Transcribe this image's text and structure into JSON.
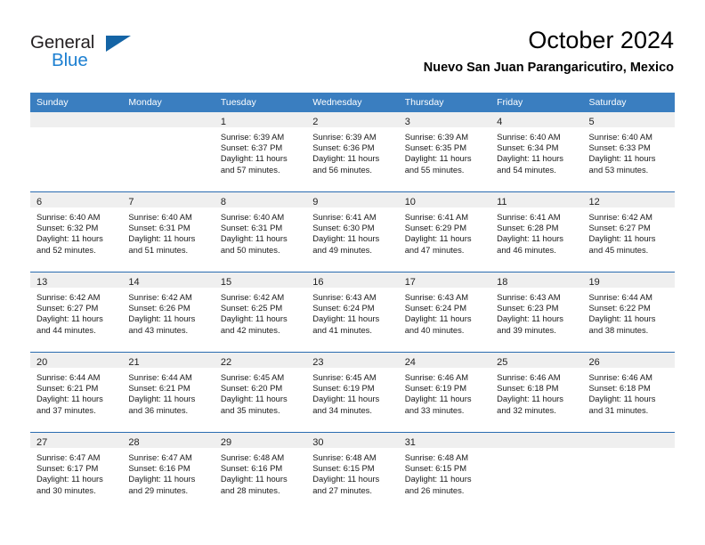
{
  "brand": {
    "name_part1": "General",
    "name_part2": "Blue",
    "logo_icon": "triangle-icon"
  },
  "header": {
    "title": "October 2024",
    "subtitle": "Nuevo San Juan Parangaricutiro, Mexico"
  },
  "calendar": {
    "weekday_headers": [
      "Sunday",
      "Monday",
      "Tuesday",
      "Wednesday",
      "Thursday",
      "Friday",
      "Saturday"
    ],
    "accent_color": "#3a7ec0",
    "separator_color": "#2a6cb0",
    "daynum_band_color": "#efefef",
    "weeks": [
      [
        {
          "day": "",
          "sunrise": "",
          "sunset": "",
          "daylight_line1": "",
          "daylight_line2": ""
        },
        {
          "day": "",
          "sunrise": "",
          "sunset": "",
          "daylight_line1": "",
          "daylight_line2": ""
        },
        {
          "day": "1",
          "sunrise": "Sunrise: 6:39 AM",
          "sunset": "Sunset: 6:37 PM",
          "daylight_line1": "Daylight: 11 hours",
          "daylight_line2": "and 57 minutes."
        },
        {
          "day": "2",
          "sunrise": "Sunrise: 6:39 AM",
          "sunset": "Sunset: 6:36 PM",
          "daylight_line1": "Daylight: 11 hours",
          "daylight_line2": "and 56 minutes."
        },
        {
          "day": "3",
          "sunrise": "Sunrise: 6:39 AM",
          "sunset": "Sunset: 6:35 PM",
          "daylight_line1": "Daylight: 11 hours",
          "daylight_line2": "and 55 minutes."
        },
        {
          "day": "4",
          "sunrise": "Sunrise: 6:40 AM",
          "sunset": "Sunset: 6:34 PM",
          "daylight_line1": "Daylight: 11 hours",
          "daylight_line2": "and 54 minutes."
        },
        {
          "day": "5",
          "sunrise": "Sunrise: 6:40 AM",
          "sunset": "Sunset: 6:33 PM",
          "daylight_line1": "Daylight: 11 hours",
          "daylight_line2": "and 53 minutes."
        }
      ],
      [
        {
          "day": "6",
          "sunrise": "Sunrise: 6:40 AM",
          "sunset": "Sunset: 6:32 PM",
          "daylight_line1": "Daylight: 11 hours",
          "daylight_line2": "and 52 minutes."
        },
        {
          "day": "7",
          "sunrise": "Sunrise: 6:40 AM",
          "sunset": "Sunset: 6:31 PM",
          "daylight_line1": "Daylight: 11 hours",
          "daylight_line2": "and 51 minutes."
        },
        {
          "day": "8",
          "sunrise": "Sunrise: 6:40 AM",
          "sunset": "Sunset: 6:31 PM",
          "daylight_line1": "Daylight: 11 hours",
          "daylight_line2": "and 50 minutes."
        },
        {
          "day": "9",
          "sunrise": "Sunrise: 6:41 AM",
          "sunset": "Sunset: 6:30 PM",
          "daylight_line1": "Daylight: 11 hours",
          "daylight_line2": "and 49 minutes."
        },
        {
          "day": "10",
          "sunrise": "Sunrise: 6:41 AM",
          "sunset": "Sunset: 6:29 PM",
          "daylight_line1": "Daylight: 11 hours",
          "daylight_line2": "and 47 minutes."
        },
        {
          "day": "11",
          "sunrise": "Sunrise: 6:41 AM",
          "sunset": "Sunset: 6:28 PM",
          "daylight_line1": "Daylight: 11 hours",
          "daylight_line2": "and 46 minutes."
        },
        {
          "day": "12",
          "sunrise": "Sunrise: 6:42 AM",
          "sunset": "Sunset: 6:27 PM",
          "daylight_line1": "Daylight: 11 hours",
          "daylight_line2": "and 45 minutes."
        }
      ],
      [
        {
          "day": "13",
          "sunrise": "Sunrise: 6:42 AM",
          "sunset": "Sunset: 6:27 PM",
          "daylight_line1": "Daylight: 11 hours",
          "daylight_line2": "and 44 minutes."
        },
        {
          "day": "14",
          "sunrise": "Sunrise: 6:42 AM",
          "sunset": "Sunset: 6:26 PM",
          "daylight_line1": "Daylight: 11 hours",
          "daylight_line2": "and 43 minutes."
        },
        {
          "day": "15",
          "sunrise": "Sunrise: 6:42 AM",
          "sunset": "Sunset: 6:25 PM",
          "daylight_line1": "Daylight: 11 hours",
          "daylight_line2": "and 42 minutes."
        },
        {
          "day": "16",
          "sunrise": "Sunrise: 6:43 AM",
          "sunset": "Sunset: 6:24 PM",
          "daylight_line1": "Daylight: 11 hours",
          "daylight_line2": "and 41 minutes."
        },
        {
          "day": "17",
          "sunrise": "Sunrise: 6:43 AM",
          "sunset": "Sunset: 6:24 PM",
          "daylight_line1": "Daylight: 11 hours",
          "daylight_line2": "and 40 minutes."
        },
        {
          "day": "18",
          "sunrise": "Sunrise: 6:43 AM",
          "sunset": "Sunset: 6:23 PM",
          "daylight_line1": "Daylight: 11 hours",
          "daylight_line2": "and 39 minutes."
        },
        {
          "day": "19",
          "sunrise": "Sunrise: 6:44 AM",
          "sunset": "Sunset: 6:22 PM",
          "daylight_line1": "Daylight: 11 hours",
          "daylight_line2": "and 38 minutes."
        }
      ],
      [
        {
          "day": "20",
          "sunrise": "Sunrise: 6:44 AM",
          "sunset": "Sunset: 6:21 PM",
          "daylight_line1": "Daylight: 11 hours",
          "daylight_line2": "and 37 minutes."
        },
        {
          "day": "21",
          "sunrise": "Sunrise: 6:44 AM",
          "sunset": "Sunset: 6:21 PM",
          "daylight_line1": "Daylight: 11 hours",
          "daylight_line2": "and 36 minutes."
        },
        {
          "day": "22",
          "sunrise": "Sunrise: 6:45 AM",
          "sunset": "Sunset: 6:20 PM",
          "daylight_line1": "Daylight: 11 hours",
          "daylight_line2": "and 35 minutes."
        },
        {
          "day": "23",
          "sunrise": "Sunrise: 6:45 AM",
          "sunset": "Sunset: 6:19 PM",
          "daylight_line1": "Daylight: 11 hours",
          "daylight_line2": "and 34 minutes."
        },
        {
          "day": "24",
          "sunrise": "Sunrise: 6:46 AM",
          "sunset": "Sunset: 6:19 PM",
          "daylight_line1": "Daylight: 11 hours",
          "daylight_line2": "and 33 minutes."
        },
        {
          "day": "25",
          "sunrise": "Sunrise: 6:46 AM",
          "sunset": "Sunset: 6:18 PM",
          "daylight_line1": "Daylight: 11 hours",
          "daylight_line2": "and 32 minutes."
        },
        {
          "day": "26",
          "sunrise": "Sunrise: 6:46 AM",
          "sunset": "Sunset: 6:18 PM",
          "daylight_line1": "Daylight: 11 hours",
          "daylight_line2": "and 31 minutes."
        }
      ],
      [
        {
          "day": "27",
          "sunrise": "Sunrise: 6:47 AM",
          "sunset": "Sunset: 6:17 PM",
          "daylight_line1": "Daylight: 11 hours",
          "daylight_line2": "and 30 minutes."
        },
        {
          "day": "28",
          "sunrise": "Sunrise: 6:47 AM",
          "sunset": "Sunset: 6:16 PM",
          "daylight_line1": "Daylight: 11 hours",
          "daylight_line2": "and 29 minutes."
        },
        {
          "day": "29",
          "sunrise": "Sunrise: 6:48 AM",
          "sunset": "Sunset: 6:16 PM",
          "daylight_line1": "Daylight: 11 hours",
          "daylight_line2": "and 28 minutes."
        },
        {
          "day": "30",
          "sunrise": "Sunrise: 6:48 AM",
          "sunset": "Sunset: 6:15 PM",
          "daylight_line1": "Daylight: 11 hours",
          "daylight_line2": "and 27 minutes."
        },
        {
          "day": "31",
          "sunrise": "Sunrise: 6:48 AM",
          "sunset": "Sunset: 6:15 PM",
          "daylight_line1": "Daylight: 11 hours",
          "daylight_line2": "and 26 minutes."
        },
        {
          "day": "",
          "sunrise": "",
          "sunset": "",
          "daylight_line1": "",
          "daylight_line2": ""
        },
        {
          "day": "",
          "sunrise": "",
          "sunset": "",
          "daylight_line1": "",
          "daylight_line2": ""
        }
      ]
    ]
  }
}
